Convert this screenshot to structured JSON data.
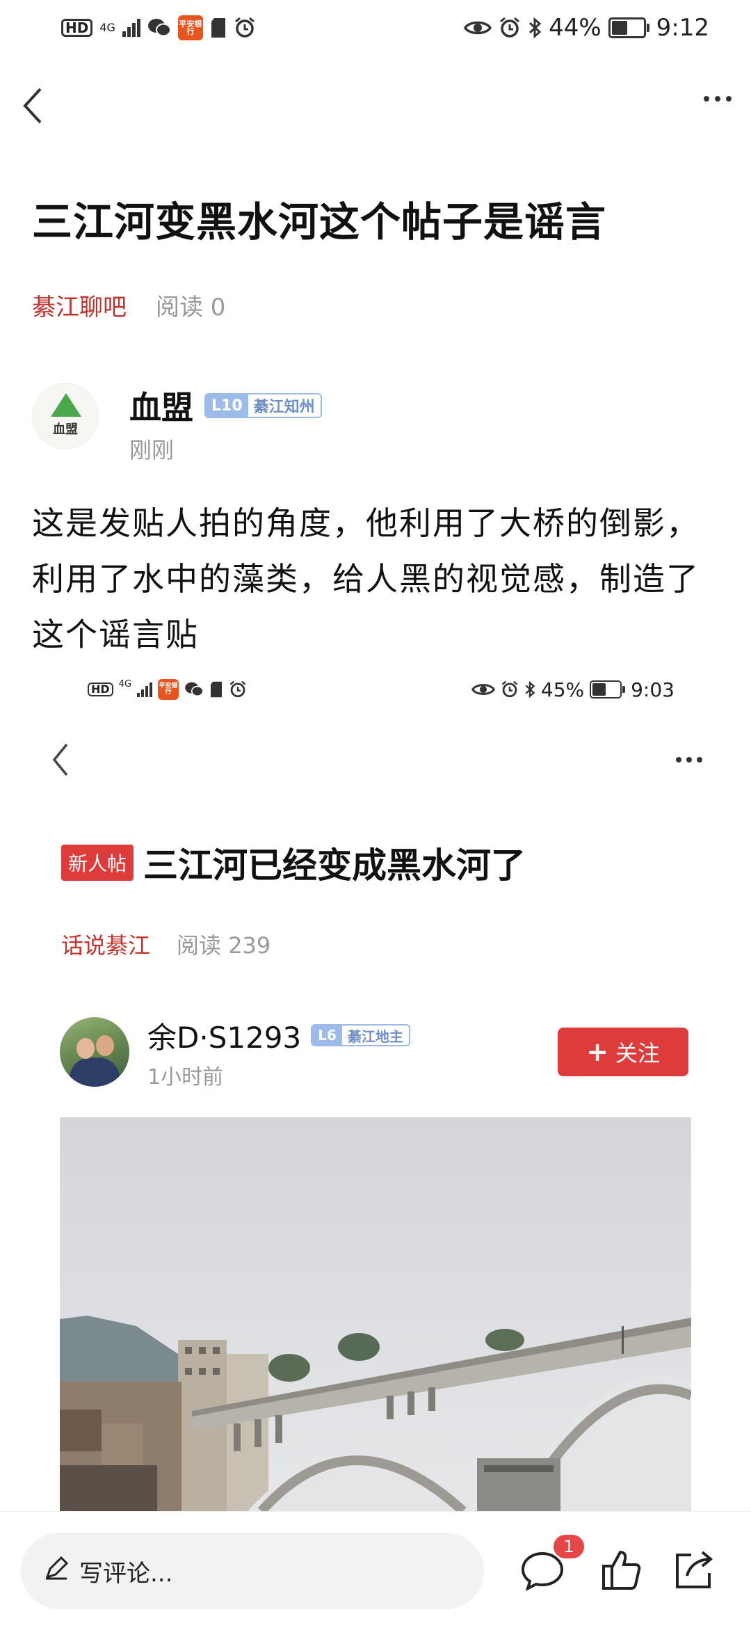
{
  "status_top": {
    "hd": "HD",
    "net": "4G",
    "app_icon_text": "平安银行",
    "battery": "44%",
    "battery_level": 0.44,
    "time": "9:12"
  },
  "post": {
    "title": "三江河变黑水河这个帖子是谣言",
    "forum": "綦江聊吧",
    "reads": "阅读 0",
    "author": {
      "name": "血盟",
      "avatar_text": "血盟",
      "level": "L10",
      "level_title": "綦江知州",
      "time": "刚刚"
    },
    "body": "这是发贴人拍的角度，他利用了大桥的倒影，利用了水中的藻类，给人黑的视觉感，制造了这个谣言贴"
  },
  "status_embedded": {
    "hd": "HD",
    "net": "4G",
    "app_icon_text": "平安银行",
    "battery": "45%",
    "battery_level": 0.45,
    "time": "9:03"
  },
  "embedded_post": {
    "tag": "新人帖",
    "title": "三江河已经变成黑水河了",
    "forum": "话说綦江",
    "reads": "阅读 239",
    "author": {
      "name": "余D·S1293",
      "level": "L6",
      "level_title": "綦江地主",
      "time": "1小时前"
    },
    "follow_label": "关注"
  },
  "bottom_bar": {
    "comment_placeholder": "写评论...",
    "comment_count": "1"
  },
  "colors": {
    "accent_red": "#dd3c3a",
    "forum_red": "#c5322d",
    "level_blue": "#9cbbe9"
  },
  "icons": [
    "back-icon",
    "more-icon",
    "eye-icon",
    "alarm-icon",
    "bluetooth-icon",
    "battery-icon",
    "wechat-icon",
    "sd-card-icon",
    "pen-icon",
    "comment-icon",
    "like-icon",
    "share-icon"
  ]
}
